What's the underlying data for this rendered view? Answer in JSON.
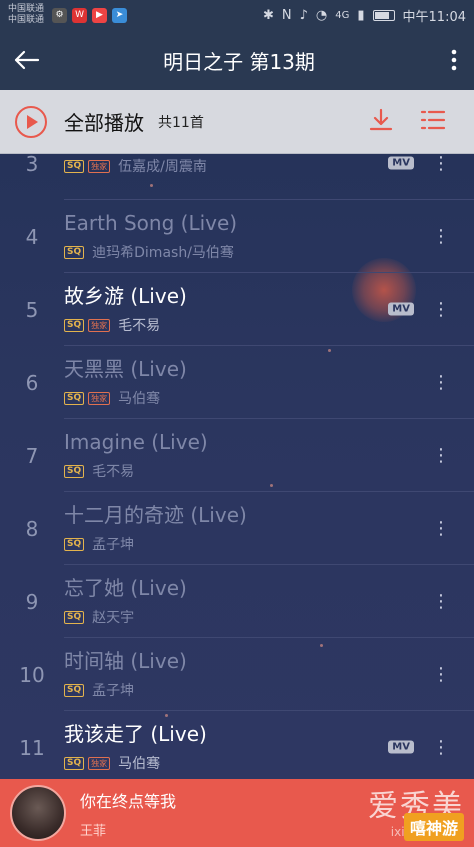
{
  "status_bar": {
    "carrier_1": "中国联通",
    "carrier_2": "中国联通",
    "time": "中午11:04",
    "network": "4G"
  },
  "header": {
    "title": "明日之子 第13期"
  },
  "play_all": {
    "label": "全部播放",
    "count": "共11首"
  },
  "songs": [
    {
      "num": "3",
      "title": "",
      "artist": "伍嘉成/周震南",
      "has_mv": true,
      "exclusive": true,
      "active": false
    },
    {
      "num": "4",
      "title": "Earth Song (Live)",
      "artist": "迪玛希Dimash/马伯骞",
      "has_mv": false,
      "exclusive": false,
      "active": false
    },
    {
      "num": "5",
      "title": "故乡游 (Live)",
      "artist": "毛不易",
      "has_mv": true,
      "exclusive": true,
      "active": true
    },
    {
      "num": "6",
      "title": "天黑黑 (Live)",
      "artist": "马伯骞",
      "has_mv": false,
      "exclusive": true,
      "active": false
    },
    {
      "num": "7",
      "title": "Imagine (Live)",
      "artist": "毛不易",
      "has_mv": false,
      "exclusive": false,
      "active": false
    },
    {
      "num": "8",
      "title": "十二月的奇迹 (Live)",
      "artist": "孟子坤",
      "has_mv": false,
      "exclusive": false,
      "active": false
    },
    {
      "num": "9",
      "title": "忘了她 (Live)",
      "artist": "赵天宇",
      "has_mv": false,
      "exclusive": false,
      "active": false
    },
    {
      "num": "10",
      "title": "时间轴 (Live)",
      "artist": "孟子坤",
      "has_mv": false,
      "exclusive": false,
      "active": false
    },
    {
      "num": "11",
      "title": "我该走了 (Live)",
      "artist": "马伯骞",
      "has_mv": true,
      "exclusive": true,
      "active": true
    }
  ],
  "badges": {
    "sq": "SQ",
    "exclusive": "独家",
    "mv": "MV"
  },
  "now_playing": {
    "song": "你在终点等我",
    "artist": "王菲"
  },
  "watermark": {
    "line1": "爱秀美",
    "line2": "ixiumei.com",
    "line3": "嘻神游"
  },
  "colors": {
    "accent": "#e8594d",
    "header_bg": "#2a3952",
    "list_bg": "#2b365f",
    "sq_gold": "#e3b34d"
  }
}
